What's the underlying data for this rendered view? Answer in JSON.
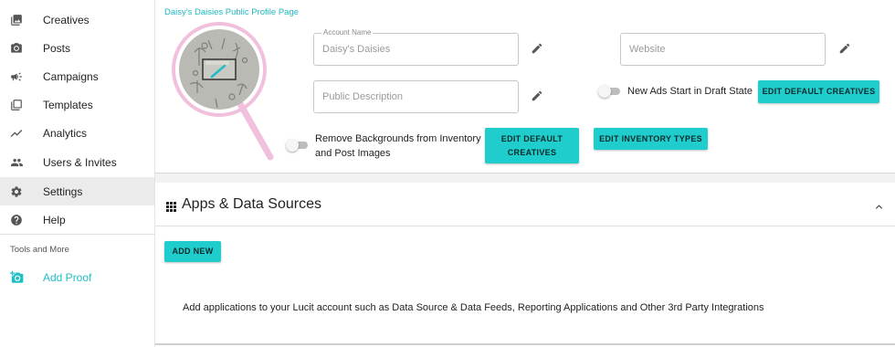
{
  "sidebar": {
    "items": [
      {
        "label": "Creatives",
        "icon": "image-icon"
      },
      {
        "label": "Posts",
        "icon": "camera-icon"
      },
      {
        "label": "Campaigns",
        "icon": "megaphone-icon"
      },
      {
        "label": "Templates",
        "icon": "template-icon"
      },
      {
        "label": "Analytics",
        "icon": "trend-icon"
      },
      {
        "label": "Users & Invites",
        "icon": "people-icon"
      },
      {
        "label": "Settings",
        "icon": "gear-icon",
        "active": true
      },
      {
        "label": "Help",
        "icon": "help-icon"
      }
    ],
    "section_title": "Tools and More",
    "add_proof": {
      "label": "Add Proof",
      "icon": "add-photo-icon"
    }
  },
  "profile": {
    "public_link": "Daisy's Daisies Public Profile Page",
    "account_name_label": "Account Name",
    "account_name_value": "Daisy's Daisies",
    "website_placeholder": "Website",
    "public_description_placeholder": "Public Description",
    "toggle_draft_label": "New Ads Start in Draft State",
    "edit_default_creatives_label": "EDIT DEFAULT CREATIVES",
    "toggle_remove_bg_label": "Remove Backgrounds from Inventory and Post Images",
    "edit_default_creatives_label_2": "EDIT DEFAULT CREATIVES",
    "edit_inventory_types_label": "EDIT INVENTORY TYPES"
  },
  "apps": {
    "title": "Apps & Data Sources",
    "add_new_label": "ADD NEW",
    "description": "Add applications to your Lucit account such as Data Source & Data Feeds, Reporting Applications and Other 3rd Party Integrations"
  },
  "colors": {
    "accent": "#1fcdcd",
    "link": "#20b8c0",
    "active_bg": "#ebebeb",
    "highlight_pink": "#f0c0dc"
  }
}
